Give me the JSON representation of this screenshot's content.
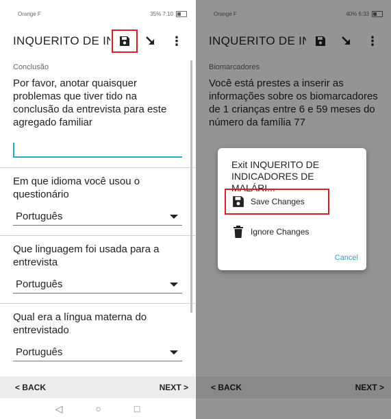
{
  "left": {
    "status": {
      "carrier": "Orange F",
      "right": "35% 7:10"
    },
    "appbar": {
      "title": "INQUERITO DE IN..."
    },
    "section": "Conclusão",
    "q1": "Por favor, anotar quaisquer problemas que tiver tido na conclusão da entrevista para este agregado familiar",
    "q1_value": "",
    "q2": "Em que idioma você usou o questionário",
    "q2_value": "Português",
    "q3": "Que linguagem foi usada para a entrevista",
    "q3_value": "Português",
    "q4": "Qual era a língua materna do entrevistado",
    "q4_value": "Português",
    "back": "< BACK",
    "next": "NEXT >"
  },
  "right": {
    "status": {
      "carrier": "Orange F",
      "right": "40% 6:33"
    },
    "appbar": {
      "title": "INQUERITO DE IN..."
    },
    "section": "Biomarcadores",
    "body": "Você está prestes a inserir as informações sobre os biomarcadores de 1 crianças entre 6 e 59 meses do número da família 77",
    "dialog": {
      "title": "Exit INQUERITO DE INDICADORES DE MALÁRI...",
      "save": "Save Changes",
      "ignore": "Ignore Changes",
      "cancel": "Cancel"
    },
    "back": "< BACK",
    "next": "NEXT >"
  },
  "icons": [
    "save-icon",
    "arrow-icon",
    "overflow-menu-icon",
    "trash-icon",
    "back-nav-icon",
    "home-nav-icon",
    "recents-nav-icon"
  ],
  "colors": {
    "accent": "#2aa7c9",
    "highlight": "#e01b24",
    "dim_overlay": "rgba(0,0,0,0.42)"
  }
}
